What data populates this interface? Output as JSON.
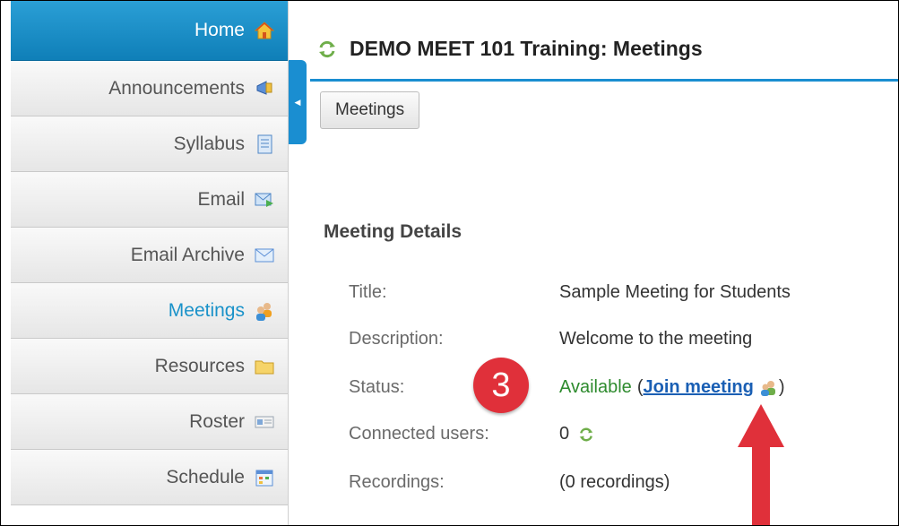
{
  "sidebar": {
    "items": [
      {
        "label": "Home",
        "icon": "home-icon"
      },
      {
        "label": "Announcements",
        "icon": "megaphone-icon"
      },
      {
        "label": "Syllabus",
        "icon": "document-icon"
      },
      {
        "label": "Email",
        "icon": "email-send-icon"
      },
      {
        "label": "Email Archive",
        "icon": "envelope-icon"
      },
      {
        "label": "Meetings",
        "icon": "users-icon"
      },
      {
        "label": "Resources",
        "icon": "folder-icon"
      },
      {
        "label": "Roster",
        "icon": "id-card-icon"
      },
      {
        "label": "Schedule",
        "icon": "calendar-icon"
      }
    ]
  },
  "main": {
    "title": "DEMO MEET 101 Training: Meetings",
    "meetings_button": "Meetings",
    "section_heading": "Meeting Details",
    "details": {
      "title_label": "Title:",
      "title_value": "Sample Meeting for Students",
      "description_label": "Description:",
      "description_value": "Welcome to the meeting",
      "status_label": "Status:",
      "status_available": "Available",
      "status_open": "(",
      "join_link": "Join meeting",
      "status_close": ")",
      "connected_label": "Connected users:",
      "connected_value": "0",
      "recordings_label": "Recordings:",
      "recordings_value": "(0 recordings)"
    }
  },
  "annotation": {
    "badge_number": "3"
  },
  "colors": {
    "accent": "#1a8ed1",
    "badge": "#e0303a",
    "available": "#2e8b2e",
    "link": "#1a5fb4"
  }
}
